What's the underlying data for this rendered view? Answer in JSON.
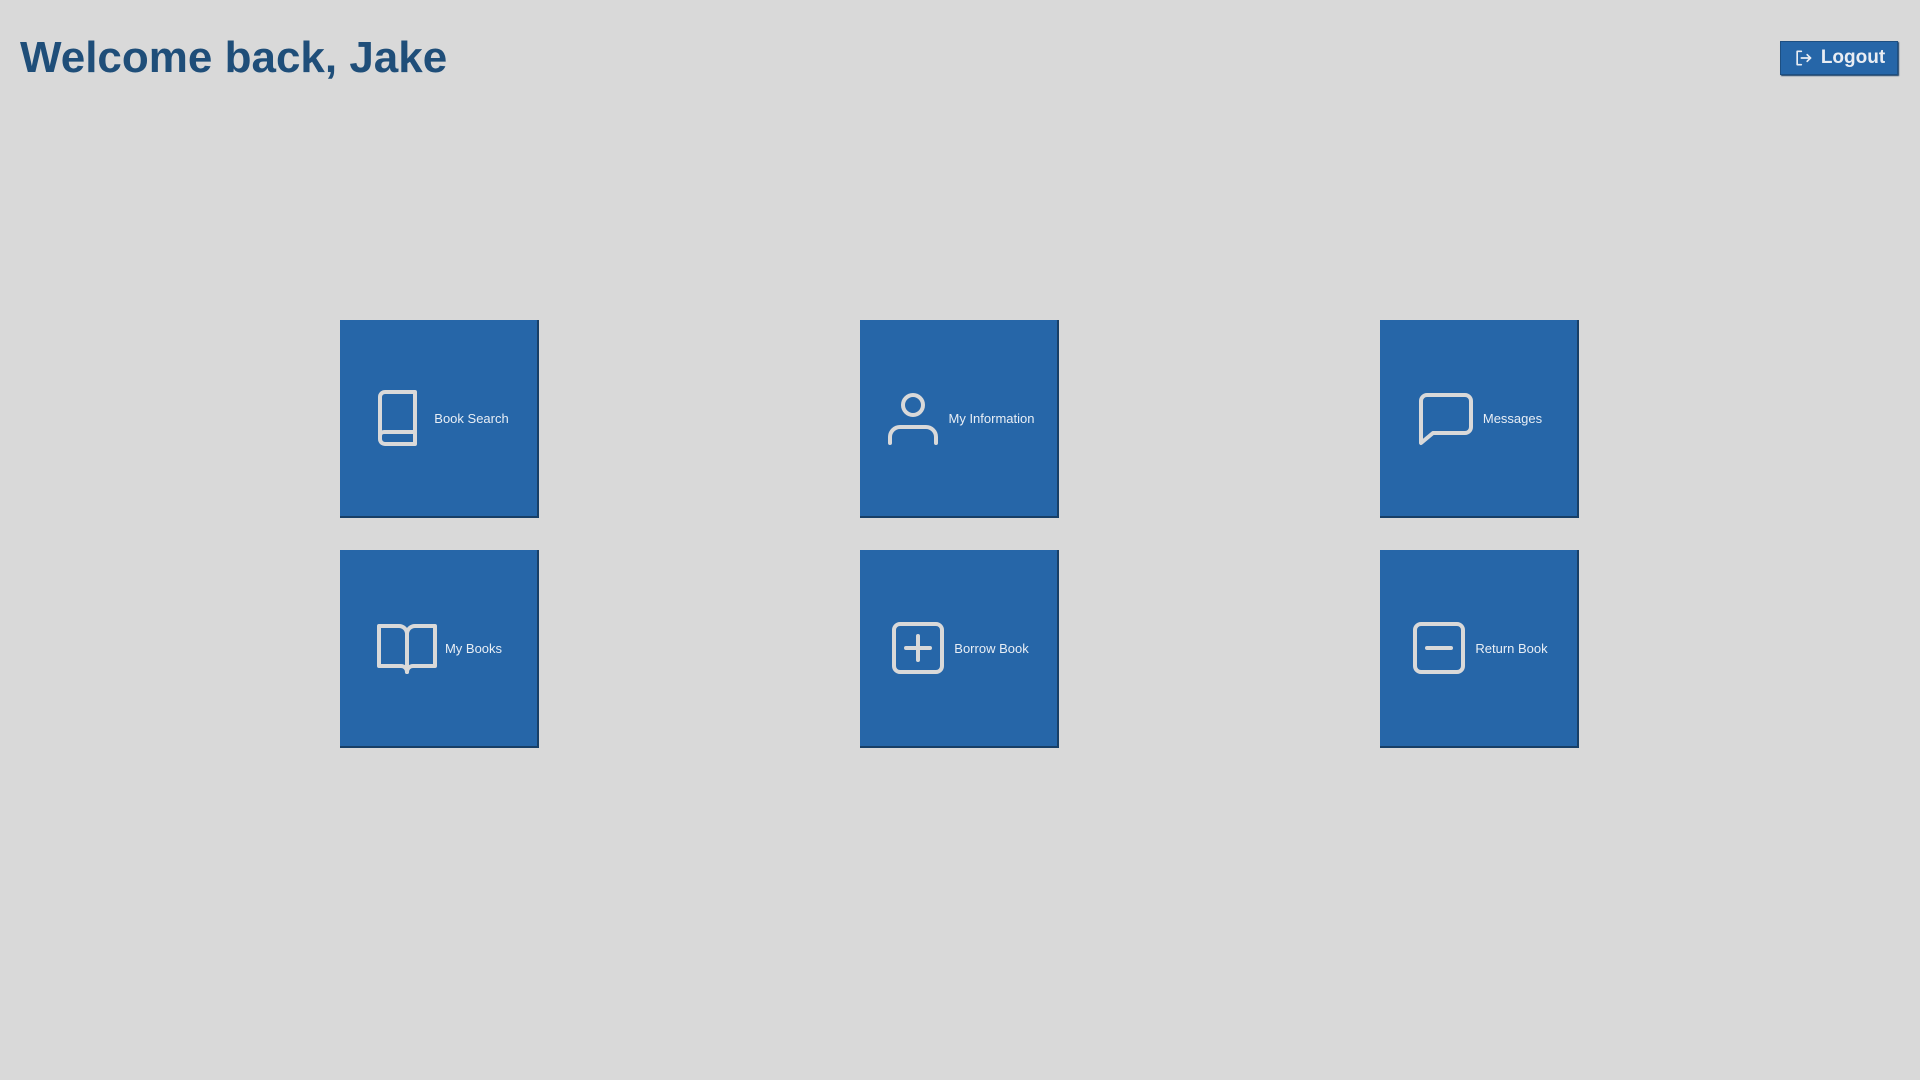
{
  "header": {
    "welcome": "Welcome back, Jake",
    "logout_label": "Logout",
    "logout_icon": "logout-icon"
  },
  "tiles": [
    {
      "label": "Book Search",
      "icon": "book-icon"
    },
    {
      "label": "My Information",
      "icon": "person-icon"
    },
    {
      "label": "Messages",
      "icon": "chat-bubble-icon"
    },
    {
      "label": "My Books",
      "icon": "open-book-icon"
    },
    {
      "label": "Borrow Book",
      "icon": "plus-square-icon"
    },
    {
      "label": "Return Book",
      "icon": "minus-square-icon"
    }
  ],
  "colors": {
    "background": "#d9d9d9",
    "tile": "#2666a8",
    "title": "#1f4e79",
    "icon": "#d9d9d9"
  }
}
